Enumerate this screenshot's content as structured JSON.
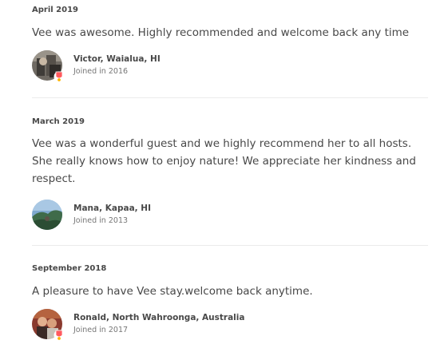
{
  "reviews": [
    {
      "date": "April 2019",
      "text": "Vee was awesome. Highly recommended and welcome back any time",
      "reviewer_name": "Victor, Waialua, HI",
      "joined": "Joined in 2016"
    },
    {
      "date": "March 2019",
      "text": "Vee was a wonderful guest and we highly recommend her to all hosts. She really knows how to enjoy nature! We appreciate her kindness and respect.",
      "reviewer_name": "Mana, Kapaa, HI",
      "joined": "Joined in 2013"
    },
    {
      "date": "September 2018",
      "text": "A pleasure to have Vee stay.welcome back anytime.",
      "reviewer_name": "Ronald, North Wahroonga, Australia",
      "joined": "Joined in 2017"
    }
  ],
  "colors": {
    "text": "#484848",
    "muted": "#767676",
    "divider": "#ebebeb",
    "badge": "#ff5a5f"
  },
  "icons": {
    "superhost": "superhost-badge-icon"
  }
}
